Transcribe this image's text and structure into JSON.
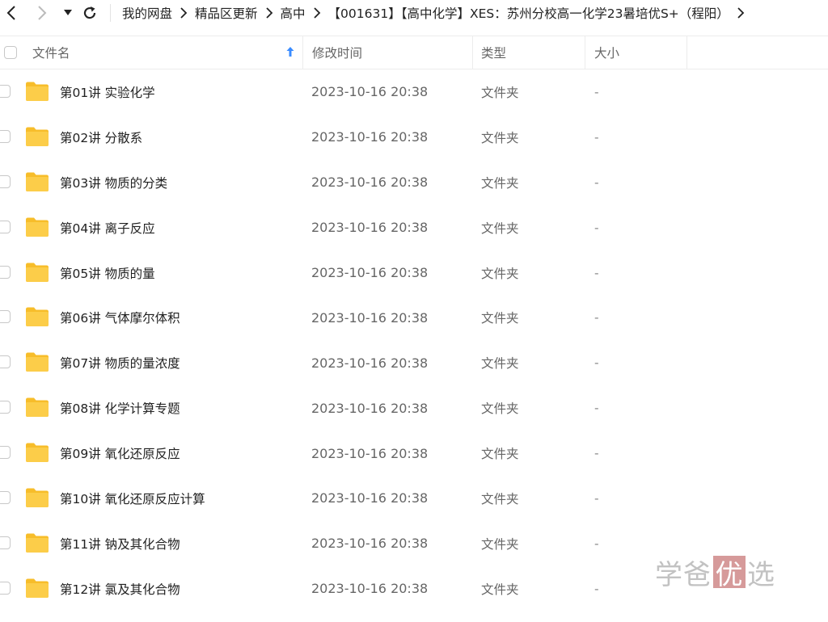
{
  "nav": {
    "back_icon": "chevron-left-icon",
    "forward_icon": "chevron-right-icon",
    "dropdown_icon": "caret-down-icon",
    "refresh_icon": "refresh-icon"
  },
  "breadcrumb": [
    "我的网盘",
    "精品区更新",
    "高中",
    "【001631】【高中化学】XES：苏州分校高一化学23暑培优S+（程阳）"
  ],
  "columns": {
    "name": "文件名",
    "modified": "修改时间",
    "type": "类型",
    "size": "大小"
  },
  "files": [
    {
      "name": "第01讲 实验化学",
      "modified": "2023-10-16 20:38",
      "type": "文件夹",
      "size": "-"
    },
    {
      "name": "第02讲 分散系",
      "modified": "2023-10-16 20:38",
      "type": "文件夹",
      "size": "-"
    },
    {
      "name": "第03讲 物质的分类",
      "modified": "2023-10-16 20:38",
      "type": "文件夹",
      "size": "-"
    },
    {
      "name": "第04讲 离子反应",
      "modified": "2023-10-16 20:38",
      "type": "文件夹",
      "size": "-"
    },
    {
      "name": "第05讲 物质的量",
      "modified": "2023-10-16 20:38",
      "type": "文件夹",
      "size": "-"
    },
    {
      "name": "第06讲 气体摩尔体积",
      "modified": "2023-10-16 20:38",
      "type": "文件夹",
      "size": "-"
    },
    {
      "name": "第07讲 物质的量浓度",
      "modified": "2023-10-16 20:38",
      "type": "文件夹",
      "size": "-"
    },
    {
      "name": "第08讲 化学计算专题",
      "modified": "2023-10-16 20:38",
      "type": "文件夹",
      "size": "-"
    },
    {
      "name": "第09讲 氧化还原反应",
      "modified": "2023-10-16 20:38",
      "type": "文件夹",
      "size": "-"
    },
    {
      "name": "第10讲 氧化还原反应计算",
      "modified": "2023-10-16 20:38",
      "type": "文件夹",
      "size": "-"
    },
    {
      "name": "第11讲 钠及其化合物",
      "modified": "2023-10-16 20:38",
      "type": "文件夹",
      "size": "-"
    },
    {
      "name": "第12讲 氯及其化合物",
      "modified": "2023-10-16 20:38",
      "type": "文件夹",
      "size": "-"
    }
  ],
  "watermark": {
    "part1": "学爸",
    "boxed": "优",
    "part3": "选"
  },
  "colors": {
    "folder": "#f9c83c",
    "sort_arrow": "#3b8cff",
    "watermark_box": "#d69a9a"
  }
}
